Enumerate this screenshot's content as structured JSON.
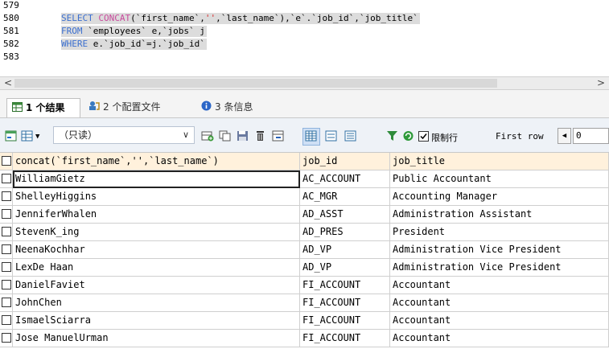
{
  "editor": {
    "lines": [
      {
        "num": "579",
        "parts": []
      },
      {
        "num": "580",
        "parts": [
          {
            "cls": "kw",
            "text": "SELECT "
          },
          {
            "cls": "fn",
            "text": "CONCAT"
          },
          {
            "cls": "plain",
            "text": "(`first_name`,"
          },
          {
            "cls": "str",
            "text": "''"
          },
          {
            "cls": "plain",
            "text": ",`last_name`),`e`.`job_id`,`job_title`"
          }
        ]
      },
      {
        "num": "581",
        "parts": [
          {
            "cls": "kw",
            "text": "FROM "
          },
          {
            "cls": "plain",
            "text": "`employees` e,`jobs` j"
          }
        ]
      },
      {
        "num": "582",
        "parts": [
          {
            "cls": "kw",
            "text": "WHERE "
          },
          {
            "cls": "plain",
            "text": "e.`job_id`=j.`job_id`"
          }
        ]
      },
      {
        "num": "583",
        "parts": []
      }
    ]
  },
  "scrollbar": {
    "left_arrow": "<",
    "right_arrow": ">"
  },
  "tabs": [
    {
      "icon": "result-grid-icon",
      "label": "1 个结果",
      "active": true
    },
    {
      "icon": "profile-icon",
      "label": "2 个配置文件",
      "active": false
    },
    {
      "icon": "info-icon",
      "label": "3 条信息",
      "active": false
    }
  ],
  "toolbar": {
    "readonly_select": "（只读）",
    "limit_rows_label": "限制行",
    "first_row_label": "First row",
    "first_row_value": "0"
  },
  "grid": {
    "columns": [
      "concat(`first_name`,'',`last_name`)",
      "job_id",
      "job_title"
    ],
    "rows": [
      [
        "WilliamGietz",
        "AC_ACCOUNT",
        "Public Accountant"
      ],
      [
        "ShelleyHiggins",
        "AC_MGR",
        "Accounting Manager"
      ],
      [
        "JenniferWhalen",
        "AD_ASST",
        "Administration Assistant"
      ],
      [
        "StevenK_ing",
        "AD_PRES",
        "President"
      ],
      [
        "NeenaKochhar",
        "AD_VP",
        "Administration Vice President"
      ],
      [
        "LexDe Haan",
        "AD_VP",
        "Administration Vice President"
      ],
      [
        "DanielFaviet",
        "FI_ACCOUNT",
        "Accountant"
      ],
      [
        "JohnChen",
        "FI_ACCOUNT",
        "Accountant"
      ],
      [
        "IsmaelSciarra",
        "FI_ACCOUNT",
        "Accountant"
      ],
      [
        "Jose ManuelUrman",
        "FI_ACCOUNT",
        "Accountant"
      ]
    ]
  }
}
